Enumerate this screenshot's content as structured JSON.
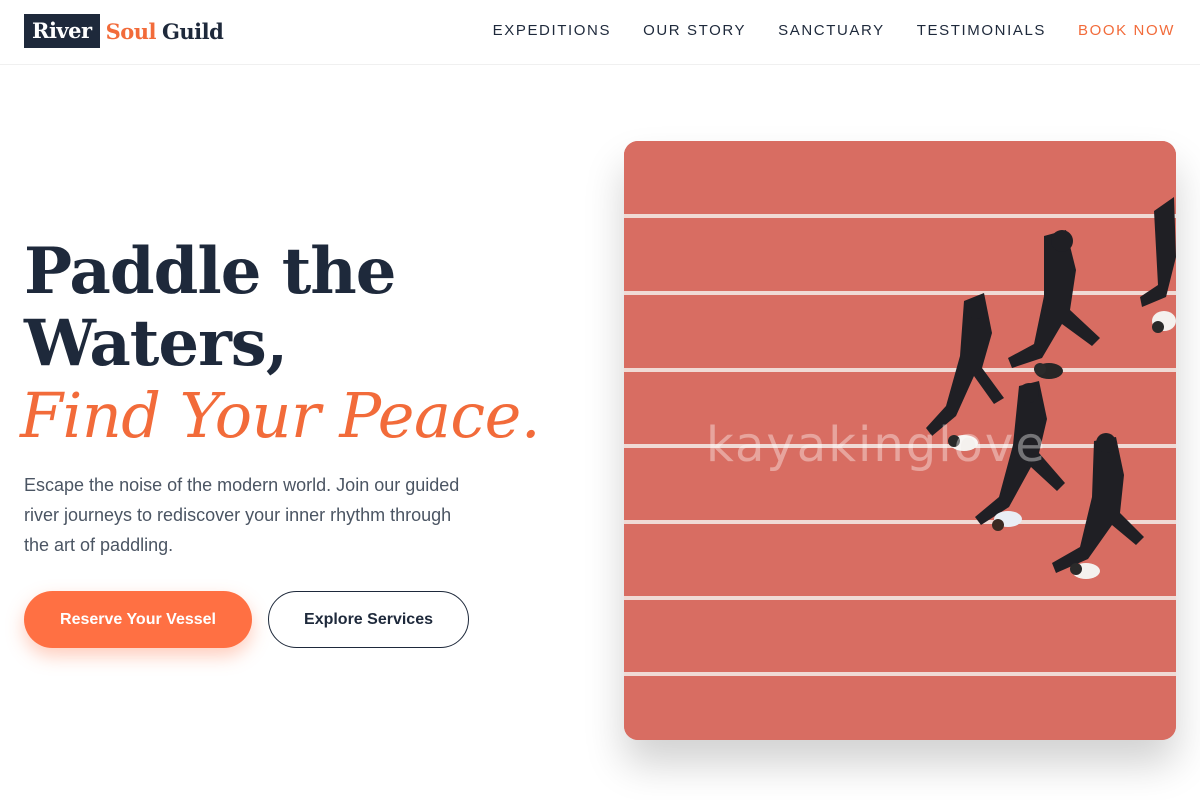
{
  "brand": {
    "part1": "River",
    "part2": "Soul",
    "part3": "Guild"
  },
  "nav": {
    "items": [
      "EXPEDITIONS",
      "OUR STORY",
      "SANCTUARY",
      "TESTIMONIALS"
    ],
    "cta": "BOOK NOW"
  },
  "hero": {
    "headline_line1": "Paddle the",
    "headline_line2": "Waters,",
    "headline_accent": "Find Your Peace.",
    "lede": "Escape the noise of the modern world. Join our guided river journeys to rediscover your inner rhythm through the art of paddling.",
    "primary_button": "Reserve Your Vessel",
    "secondary_button": "Explore Services",
    "image_watermark": "kayakinglove"
  },
  "colors": {
    "accent": "#f26b3a",
    "navy": "#1e293b",
    "track": "#d86d62"
  }
}
